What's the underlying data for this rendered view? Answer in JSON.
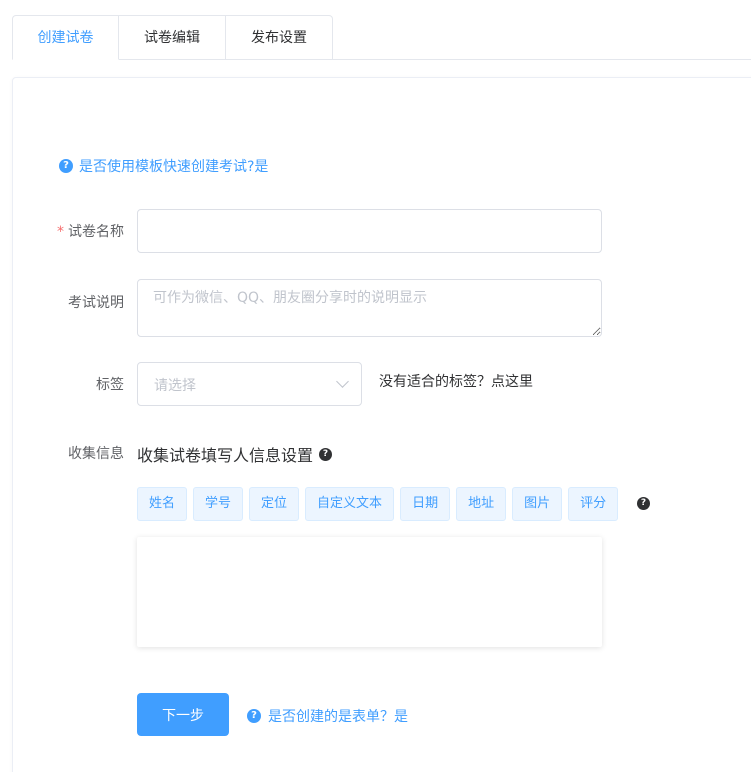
{
  "tabs": [
    {
      "label": "创建试卷",
      "active": true
    },
    {
      "label": "试卷编辑",
      "active": false
    },
    {
      "label": "发布设置",
      "active": false
    }
  ],
  "template_hint": {
    "icon": "question-circle-icon",
    "text": "是否使用模板快速创建考试?是"
  },
  "form": {
    "name": {
      "label": "试卷名称",
      "required_mark": "*",
      "value": "",
      "placeholder": ""
    },
    "description": {
      "label": "考试说明",
      "value": "",
      "placeholder": "可作为微信、QQ、朋友圈分享时的说明显示"
    },
    "tags": {
      "label": "标签",
      "placeholder": "请选择",
      "icon": "chevron-down-icon",
      "create_link": "没有适合的标签？点这里"
    },
    "collect": {
      "label": "收集信息",
      "title": "收集试卷填写人信息设置",
      "title_icon": "question-circle-icon",
      "chips": [
        "姓名",
        "学号",
        "定位",
        "自定义文本",
        "日期",
        "地址",
        "图片",
        "评分"
      ],
      "chips_icon": "question-circle-icon"
    }
  },
  "footer": {
    "next_label": "下一步",
    "form_hint": "是否创建的是表单？是"
  },
  "colors": {
    "primary": "#409eff",
    "required": "#f56c6c",
    "chip_bg": "#ecf5ff"
  }
}
